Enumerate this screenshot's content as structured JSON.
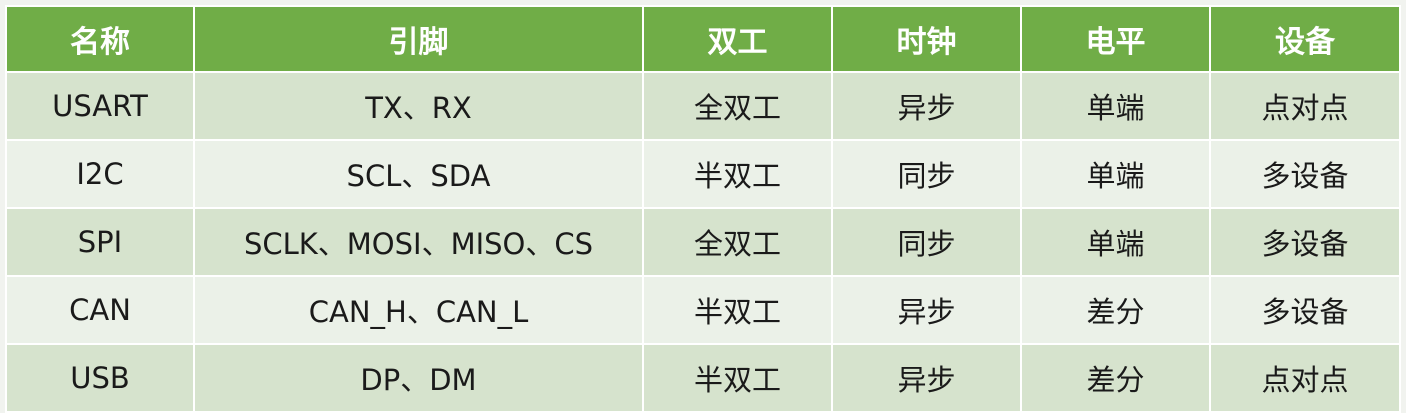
{
  "table": {
    "headers": [
      "名称",
      "引脚",
      "双工",
      "时钟",
      "电平",
      "设备"
    ],
    "rows": [
      [
        "USART",
        "TX、RX",
        "全双工",
        "异步",
        "单端",
        "点对点"
      ],
      [
        "I2C",
        "SCL、SDA",
        "半双工",
        "同步",
        "单端",
        "多设备"
      ],
      [
        "SPI",
        "SCLK、MOSI、MISO、CS",
        "全双工",
        "同步",
        "单端",
        "多设备"
      ],
      [
        "CAN",
        "CAN_H、CAN_L",
        "半双工",
        "异步",
        "差分",
        "多设备"
      ],
      [
        "USB",
        "DP、DM",
        "半双工",
        "异步",
        "差分",
        "点对点"
      ]
    ]
  },
  "colors": {
    "header_bg": "#70ad47",
    "header_text": "#ffffff",
    "row_odd_bg": "#d6e3cd",
    "row_even_bg": "#ebf1e8",
    "grid_line": "#ffffff"
  }
}
